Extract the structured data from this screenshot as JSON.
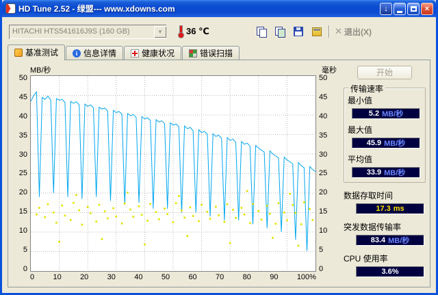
{
  "window": {
    "title": "HD Tune 2.52 - 绿盟--- www.xdowns.com"
  },
  "toolbar": {
    "drive_select": "HITACHI HTS541616J9S (160 GB)",
    "temperature": "36 ℃",
    "exit_label": "退出(X)"
  },
  "tabs": [
    {
      "label": "基准测试"
    },
    {
      "label": "信息详情"
    },
    {
      "label": "健康状况"
    },
    {
      "label": "错误扫描"
    }
  ],
  "side": {
    "start_button": "开始",
    "transfer_group": {
      "title": "传输速率",
      "rows": [
        {
          "label": "最小值",
          "value": "5.2",
          "unit": "MB/秒"
        },
        {
          "label": "最大值",
          "value": "45.9",
          "unit": "MB/秒"
        },
        {
          "label": "平均值",
          "value": "33.9",
          "unit": "MB/秒"
        }
      ]
    },
    "access_time": {
      "label": "数据存取时间",
      "value": "17.3",
      "unit": "ms"
    },
    "burst_rate": {
      "label": "突发数据传输率",
      "value": "83.4",
      "unit": "MB/秒"
    },
    "cpu": {
      "label": "CPU 使用率",
      "value": "3.6%",
      "unit": ""
    }
  },
  "chart_data": {
    "type": "line",
    "x_ticks": [
      "0",
      "10",
      "20",
      "30",
      "40",
      "50",
      "60",
      "70",
      "80",
      "90",
      "100%"
    ],
    "left_axis": {
      "label": "MB/秒",
      "min": 0,
      "max": 50,
      "ticks": [
        "50",
        "45",
        "40",
        "35",
        "30",
        "25",
        "20",
        "15",
        "10",
        "5",
        "0"
      ]
    },
    "right_axis": {
      "label": "毫秒",
      "min": 0,
      "max": 50,
      "ticks": [
        "50",
        "45",
        "40",
        "35",
        "30",
        "25",
        "20",
        "15",
        "10",
        "5",
        "0"
      ]
    },
    "grid": true,
    "series": [
      {
        "name": "transfer-rate",
        "kind": "line",
        "color": "#00a6f0",
        "x": [
          0,
          1,
          2,
          3,
          4,
          5,
          6,
          7,
          8,
          9,
          10,
          11,
          12,
          13,
          14,
          15,
          16,
          17,
          18,
          19,
          20,
          21,
          22,
          23,
          24,
          25,
          26,
          27,
          28,
          29,
          30,
          31,
          32,
          33,
          34,
          35,
          36,
          37,
          38,
          39,
          40,
          41,
          42,
          43,
          44,
          45,
          46,
          47,
          48,
          49,
          50,
          51,
          52,
          53,
          54,
          55,
          56,
          57,
          58,
          59,
          60,
          61,
          62,
          63,
          64,
          65,
          66,
          67,
          68,
          69,
          70,
          71,
          72,
          73,
          74,
          75,
          76,
          77,
          78,
          79,
          80,
          81,
          82,
          83,
          84,
          85,
          86,
          87,
          88,
          89,
          90,
          91,
          92,
          93,
          94,
          95,
          96,
          97,
          98,
          99,
          100
        ],
        "y": [
          43.5,
          45.0,
          45.9,
          19.0,
          44.5,
          44.0,
          44.8,
          43.9,
          20.0,
          44.2,
          43.8,
          44.0,
          43.2,
          19.0,
          43.5,
          43.0,
          43.4,
          42.6,
          18.5,
          42.8,
          42.2,
          42.6,
          41.8,
          19.0,
          42.0,
          41.5,
          41.8,
          41.0,
          18.0,
          41.2,
          40.6,
          40.9,
          40.2,
          17.0,
          40.4,
          39.8,
          40.1,
          39.4,
          17.5,
          39.6,
          39.0,
          39.3,
          38.6,
          16.0,
          38.8,
          38.2,
          38.5,
          37.8,
          16.0,
          38.0,
          37.4,
          37.7,
          37.0,
          15.0,
          37.2,
          36.5,
          36.8,
          36.0,
          15.0,
          36.2,
          35.5,
          35.8,
          35.0,
          14.0,
          35.2,
          34.5,
          34.8,
          34.0,
          13.0,
          34.2,
          33.5,
          33.8,
          33.0,
          13.0,
          33.2,
          32.5,
          32.8,
          32.0,
          12.0,
          32.2,
          31.5,
          31.0,
          30.5,
          11.0,
          30.8,
          30.0,
          29.5,
          29.0,
          10.0,
          29.2,
          28.5,
          28.0,
          27.5,
          8.0,
          27.8,
          27.0,
          26.5,
          5.2,
          26.8,
          26.0,
          25.5
        ]
      },
      {
        "name": "access-time",
        "kind": "scatter",
        "color": "#e3e300",
        "x": [
          2,
          3,
          5,
          6,
          8,
          9,
          11,
          12,
          14,
          15,
          17,
          18,
          20,
          21,
          23,
          24,
          26,
          27,
          29,
          30,
          32,
          33,
          35,
          36,
          38,
          39,
          41,
          42,
          44,
          45,
          47,
          48,
          50,
          51,
          53,
          54,
          56,
          57,
          59,
          60,
          62,
          63,
          65,
          66,
          68,
          69,
          71,
          72,
          74,
          75,
          77,
          78,
          80,
          81,
          83,
          84,
          86,
          87,
          89,
          90,
          92,
          93,
          95,
          96,
          98,
          99,
          10,
          25,
          40,
          55,
          70,
          85,
          94,
          16,
          34,
          52,
          76,
          91
        ],
        "y": [
          14.5,
          16.2,
          13.8,
          17.1,
          15.0,
          12.4,
          16.8,
          14.2,
          13.1,
          17.5,
          15.6,
          11.9,
          16.4,
          14.8,
          12.7,
          17.0,
          15.3,
          13.5,
          16.1,
          14.0,
          12.2,
          17.3,
          15.8,
          13.9,
          16.6,
          14.4,
          12.9,
          17.2,
          15.1,
          13.3,
          16.0,
          14.6,
          12.5,
          17.4,
          15.5,
          13.7,
          16.3,
          14.1,
          12.8,
          17.0,
          15.2,
          13.4,
          16.5,
          14.3,
          12.6,
          17.1,
          15.7,
          13.6,
          16.2,
          14.5,
          12.3,
          17.2,
          15.4,
          13.2,
          16.7,
          14.7,
          12.1,
          17.4,
          15.0,
          13.0,
          16.9,
          14.9,
          12.0,
          17.6,
          15.9,
          13.1,
          7.5,
          8.2,
          6.8,
          9.0,
          7.2,
          8.5,
          6.5,
          19.5,
          20.1,
          19.2,
          20.5,
          19.8
        ]
      }
    ]
  }
}
